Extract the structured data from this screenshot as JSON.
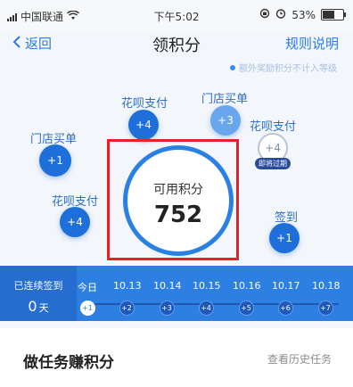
{
  "status_bar": {
    "carrier": "中国联通",
    "time": "下午5:02",
    "battery": "53%"
  },
  "nav": {
    "back_label": "返回",
    "title": "领积分",
    "rules_label": "规则说明"
  },
  "notice": "额外奖励积分不计入等级",
  "points": {
    "label": "可用积分",
    "value": "752"
  },
  "bubbles": [
    {
      "label": "门店买单",
      "value": "+1"
    },
    {
      "label": "花呗支付",
      "value": "+4"
    },
    {
      "label": "门店买单",
      "value": "+3"
    },
    {
      "label": "花呗支付",
      "value": "+4",
      "tag": "即将过期"
    },
    {
      "label": "花呗支付",
      "value": "+4"
    },
    {
      "label": "签到",
      "value": "+1"
    }
  ],
  "checkin": {
    "streak_label": "已连续签到",
    "streak_value": "0",
    "streak_unit": "天",
    "days": [
      {
        "date": "今日",
        "points": "+1"
      },
      {
        "date": "10.13",
        "points": "+2"
      },
      {
        "date": "10.14",
        "points": "+3"
      },
      {
        "date": "10.15",
        "points": "+4"
      },
      {
        "date": "10.16",
        "points": "+5"
      },
      {
        "date": "10.17",
        "points": "+6"
      },
      {
        "date": "10.18",
        "points": "+7"
      }
    ]
  },
  "tasks": {
    "title": "做任务赚积分",
    "history_label": "查看历史任务"
  },
  "colors": {
    "primary": "#2d7fe2",
    "bubble": "#1e6fd9",
    "highlight_box": "#e8202a"
  }
}
